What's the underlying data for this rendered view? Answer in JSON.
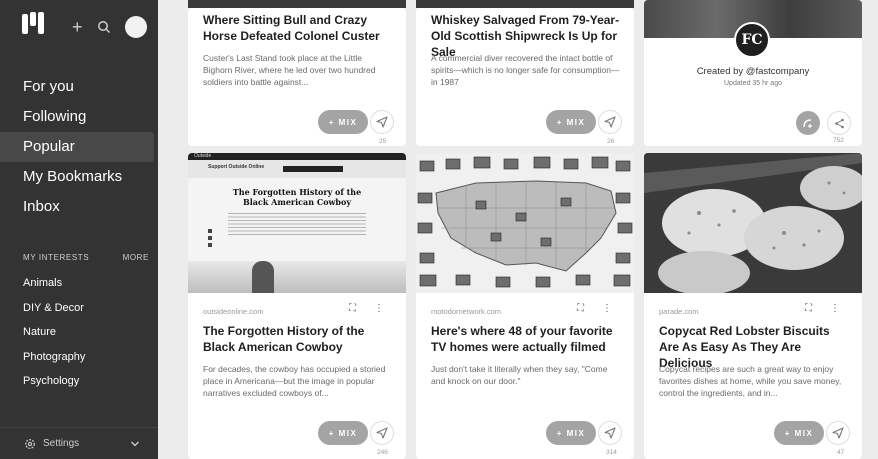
{
  "sidebar": {
    "nav": [
      {
        "label": "For you",
        "active": false
      },
      {
        "label": "Following",
        "active": false
      },
      {
        "label": "Popular",
        "active": true
      },
      {
        "label": "My Bookmarks",
        "active": false
      },
      {
        "label": "Inbox",
        "active": false
      }
    ],
    "interests_heading": "MY INTERESTS",
    "more_label": "MORE",
    "interests": [
      "Animals",
      "DIY & Decor",
      "Nature",
      "Photography",
      "Psychology"
    ],
    "settings_label": "Settings"
  },
  "mix_label": "+ MIX",
  "cards_top": [
    {
      "title": "Where Sitting Bull and Crazy Horse Defeated Colonel Custer",
      "desc": "Custer's Last Stand took place at the Little Bighorn River, where he led over two hundred soldiers into battle against...",
      "count": "25"
    },
    {
      "title": "Whiskey Salvaged From 79-Year-Old Scottish Shipwreck Is Up for Sale",
      "desc": "A commercial diver recovered the intact bottle of spirits—which is no longer safe for consumption—in 1987",
      "count": "26"
    },
    {
      "logo_text": "FC",
      "created_by": "Created by @fastcompany",
      "updated": "Updated 35 hr ago",
      "count": "752"
    }
  ],
  "cards_bottom": [
    {
      "source": "outsideonline.com",
      "title": "The Forgotten History of the Black American Cowboy",
      "desc": "For decades, the cowboy has occupied a storied place in Americana—but the image in popular narratives excluded cowboys of...",
      "count": "246",
      "thumb_headline": "The Forgotten History of the Black American Cowboy",
      "thumb_brand": "Outside",
      "thumb_section": "Support Outside Online"
    },
    {
      "source": "motodornetwork.com",
      "title": "Here's where 48 of your favorite TV homes were actually filmed",
      "desc": "Just don't take it literally when they say, \"Come and knock on our door.\"",
      "count": "314"
    },
    {
      "source": "parade.com",
      "title": "Copycat Red Lobster Biscuits Are As Easy As They Are Delicious",
      "desc": "Copycat recipes are such a great way to enjoy favorites dishes at home, while you save money, control the ingredients, and in...",
      "count": "47"
    }
  ],
  "colors": {
    "sidebar": "#333333",
    "active": "#484848",
    "background": "#ececec",
    "mix": "#a4a4a4"
  }
}
